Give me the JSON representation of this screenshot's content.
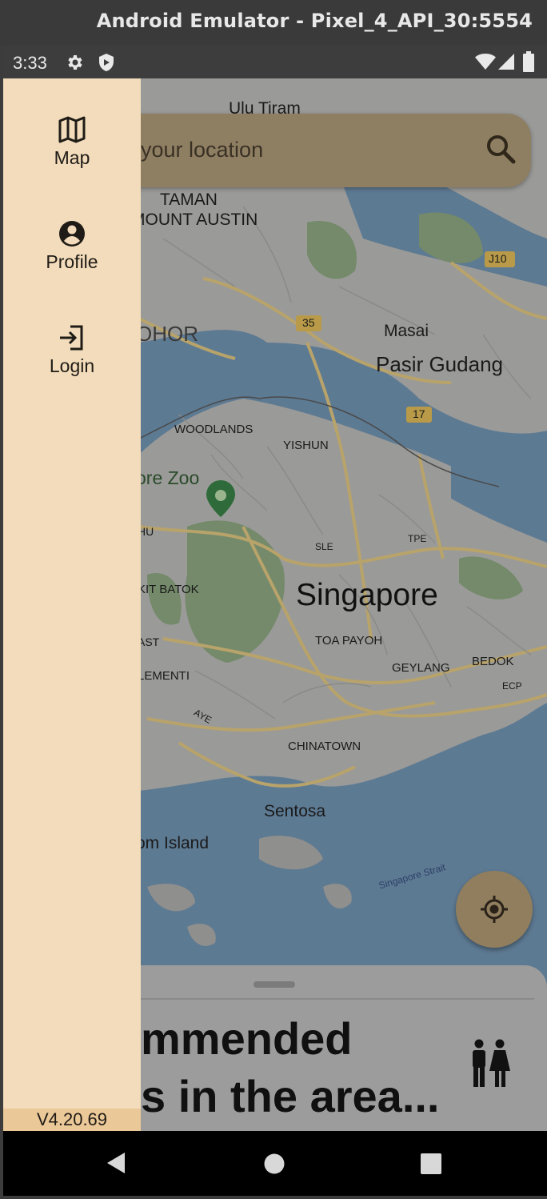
{
  "window": {
    "title": "Android Emulator - Pixel_4_API_30:5554"
  },
  "status_bar": {
    "time": "3:33",
    "icons": [
      "settings-icon",
      "shield-icon",
      "wifi-icon",
      "signal-icon",
      "battery-icon"
    ]
  },
  "search": {
    "placeholder": "your location"
  },
  "map_labels": {
    "ulu_tiram": "Ulu Tiram",
    "taman": "TAMAN",
    "mount_austin": "MOUNT AUSTIN",
    "johor": "OHOR",
    "masai": "Masai",
    "pasir_gudang": "Pasir Gudang",
    "woodlands": "WOODLANDS",
    "yishun": "YISHUN",
    "zoo": "ore Zoo",
    "hu": "HU",
    "bukit_batok": "KIT BATOK",
    "singapore": "Singapore",
    "toa_payoh": "TOA PAYOH",
    "geylang": "GEYLANG",
    "bedok": "BEDOK",
    "ast": "AST",
    "clementi": "LEMENTI",
    "chinatown": "CHINATOWN",
    "sentosa": "Sentosa",
    "island": "om Island",
    "strait": "Singapore Strait",
    "sle": "SLE",
    "tpe": "TPE",
    "ecp": "ECP",
    "aye": "AYE",
    "road_35": "35",
    "road_17": "17",
    "road_j10": "J10"
  },
  "drawer": {
    "items": [
      {
        "label": "Map",
        "icon": "map-icon"
      },
      {
        "label": "Profile",
        "icon": "account-circle-icon"
      },
      {
        "label": "Login",
        "icon": "login-icon"
      }
    ],
    "version": "V4.20.69"
  },
  "sheet": {
    "heading_line1": "mmended",
    "heading_line2": "s in the area...",
    "icon": "restroom-icon"
  },
  "colors": {
    "drawer_bg": "#f2dcbb",
    "version_bg": "#ebc898",
    "scrim_tint": "#8e7e62"
  }
}
